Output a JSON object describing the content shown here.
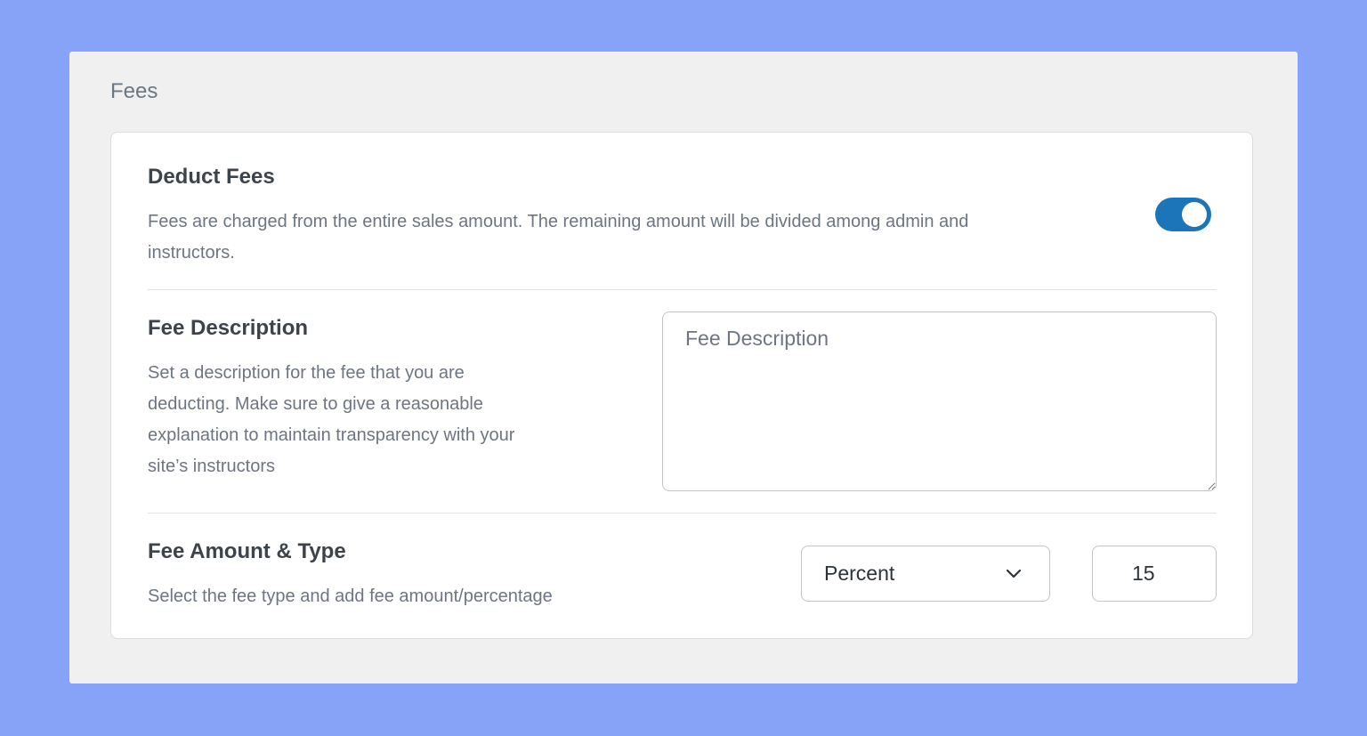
{
  "panel": {
    "title": "Fees"
  },
  "deduct_fees": {
    "title": "Deduct Fees",
    "description_line1": "Fees are charged from the entire sales amount. The remaining amount will be divided among admin and",
    "description_line2": "instructors.",
    "enabled": true,
    "toggle_color": "#1b75b8"
  },
  "fee_description": {
    "title": "Fee Description",
    "description_lines": [
      "Set a description for the fee that you are",
      "deducting. Make sure to give a reasonable",
      "explanation to maintain transparency with your",
      "site’s instructors"
    ],
    "placeholder": "Fee Description",
    "value": ""
  },
  "fee_amount": {
    "title": "Fee Amount & Type",
    "description": "Select the fee type and add fee amount/percentage",
    "type_selected": "Percent",
    "amount": "15"
  },
  "icons": {
    "select_arrow": "chevron-down-icon"
  },
  "colors": {
    "background": "#87a3f8",
    "panel": "#f0f0f1",
    "card": "#ffffff"
  }
}
